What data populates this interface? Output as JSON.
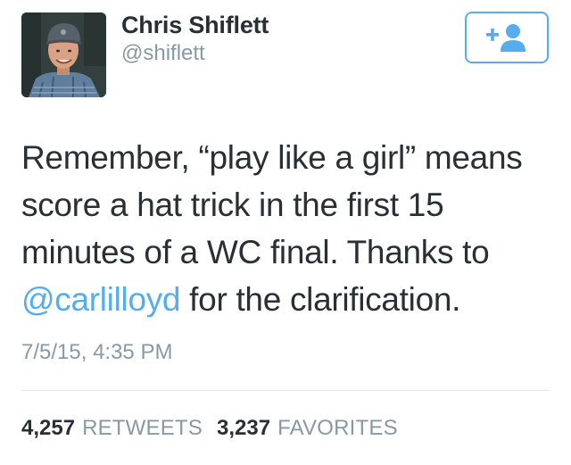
{
  "user": {
    "display_name": "Chris Shiflett",
    "handle": "@shiflett"
  },
  "follow_button": {
    "icon": "follow-user-plus-icon",
    "color": "#55acee"
  },
  "tweet": {
    "text_part1": "Remember, “play like a girl” means score a hat trick in the first 15 minutes of a WC final. Thanks to ",
    "mention": "@carlilloyd",
    "text_part2": " for the clarification.",
    "timestamp": "7/5/15, 4:35 PM"
  },
  "stats": {
    "retweets_count": "4,257",
    "retweets_label": "RETWEETS",
    "favorites_count": "3,237",
    "favorites_label": "FAVORITES"
  },
  "colors": {
    "accent": "#55acee",
    "text": "#292f33",
    "muted": "#8899a6",
    "divider": "#e1e8ed"
  }
}
